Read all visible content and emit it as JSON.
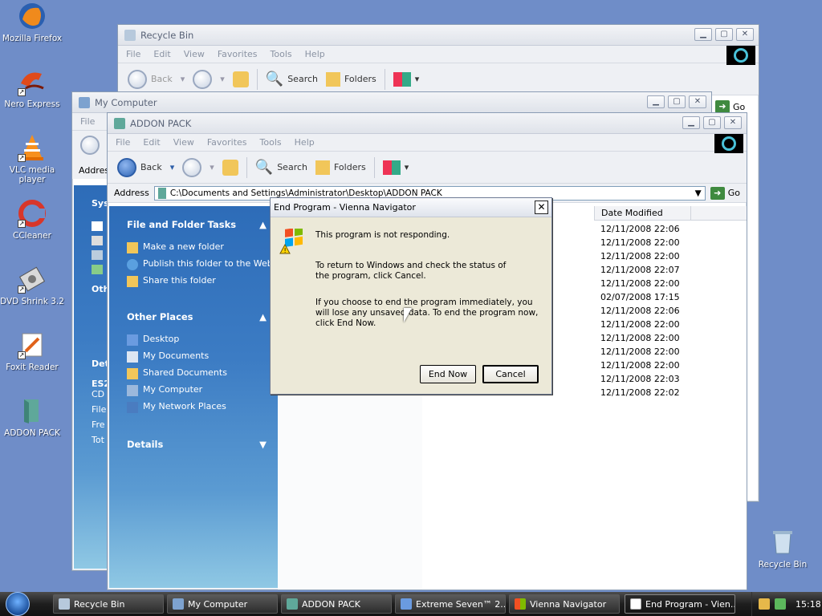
{
  "desktop": {
    "icons": [
      {
        "label": "Mozilla Firefox"
      },
      {
        "label": "Nero Express"
      },
      {
        "label": "VLC media player"
      },
      {
        "label": "CCleaner"
      },
      {
        "label": "DVD Shrink 3.2"
      },
      {
        "label": "Foxit Reader"
      },
      {
        "label": "ADDON PACK"
      },
      {
        "label": "Recycle Bin"
      }
    ]
  },
  "windows": {
    "recycle_bin": {
      "title": "Recycle Bin",
      "menu": [
        "File",
        "Edit",
        "View",
        "Favorites",
        "Tools",
        "Help"
      ],
      "toolbar": {
        "back": "Back",
        "search": "Search",
        "folders": "Folders"
      },
      "go": "Go"
    },
    "my_computer": {
      "title": "My Computer",
      "menu": [
        "File"
      ],
      "address_label": "Addres",
      "sidebar": [
        "Sys",
        "Oth",
        "Det",
        "ES2",
        "CD",
        "File",
        "Fre",
        "Tot"
      ]
    },
    "addon_pack": {
      "title": "ADDON PACK",
      "menu": [
        "File",
        "Edit",
        "View",
        "Favorites",
        "Tools",
        "Help"
      ],
      "toolbar": {
        "back": "Back",
        "search": "Search",
        "folders": "Folders"
      },
      "address_label": "Address",
      "address_value": "C:\\Documents and Settings\\Administrator\\Desktop\\ADDON PACK",
      "go": "Go",
      "tasks": {
        "file_folder_title": "File and Folder Tasks",
        "file_folder_items": [
          "Make a new folder",
          "Publish this folder to the Web",
          "Share this folder"
        ],
        "other_title": "Other Places",
        "other_items": [
          "Desktop",
          "My Documents",
          "Shared Documents",
          "My Computer",
          "My Network Places"
        ],
        "details_title": "Details"
      },
      "column_date": "Date Modified",
      "dates": [
        "12/11/2008 22:06",
        "12/11/2008 22:00",
        "12/11/2008 22:00",
        "12/11/2008 22:07",
        "12/11/2008 22:00",
        "02/07/2008 17:15",
        "12/11/2008 22:06",
        "12/11/2008 22:00",
        "12/11/2008 22:00",
        "12/11/2008 22:00",
        "12/11/2008 22:00",
        "12/11/2008 22:03",
        "12/11/2008 22:02"
      ]
    }
  },
  "dialog": {
    "title": "End Program - Vienna Navigator",
    "line1": "This program is not responding.",
    "line2": "To return to Windows and check the status of the program, click Cancel.",
    "line3": "If you choose to end the program immediately, you will lose any unsaved data. To end the program now, click End Now.",
    "end_now": "End Now",
    "cancel": "Cancel"
  },
  "taskbar": {
    "buttons": [
      {
        "label": "Recycle Bin"
      },
      {
        "label": "My Computer"
      },
      {
        "label": "ADDON PACK"
      },
      {
        "label": "Extreme Seven™ 2..."
      },
      {
        "label": "Vienna Navigator"
      },
      {
        "label": "End Program - Vien..."
      }
    ],
    "clock": "15:18"
  },
  "colors": {
    "desktop_bg": "#6f8dc8",
    "taskbar_bg": "#1e1e1e",
    "taskpane_blue": "#2d6cb8"
  }
}
